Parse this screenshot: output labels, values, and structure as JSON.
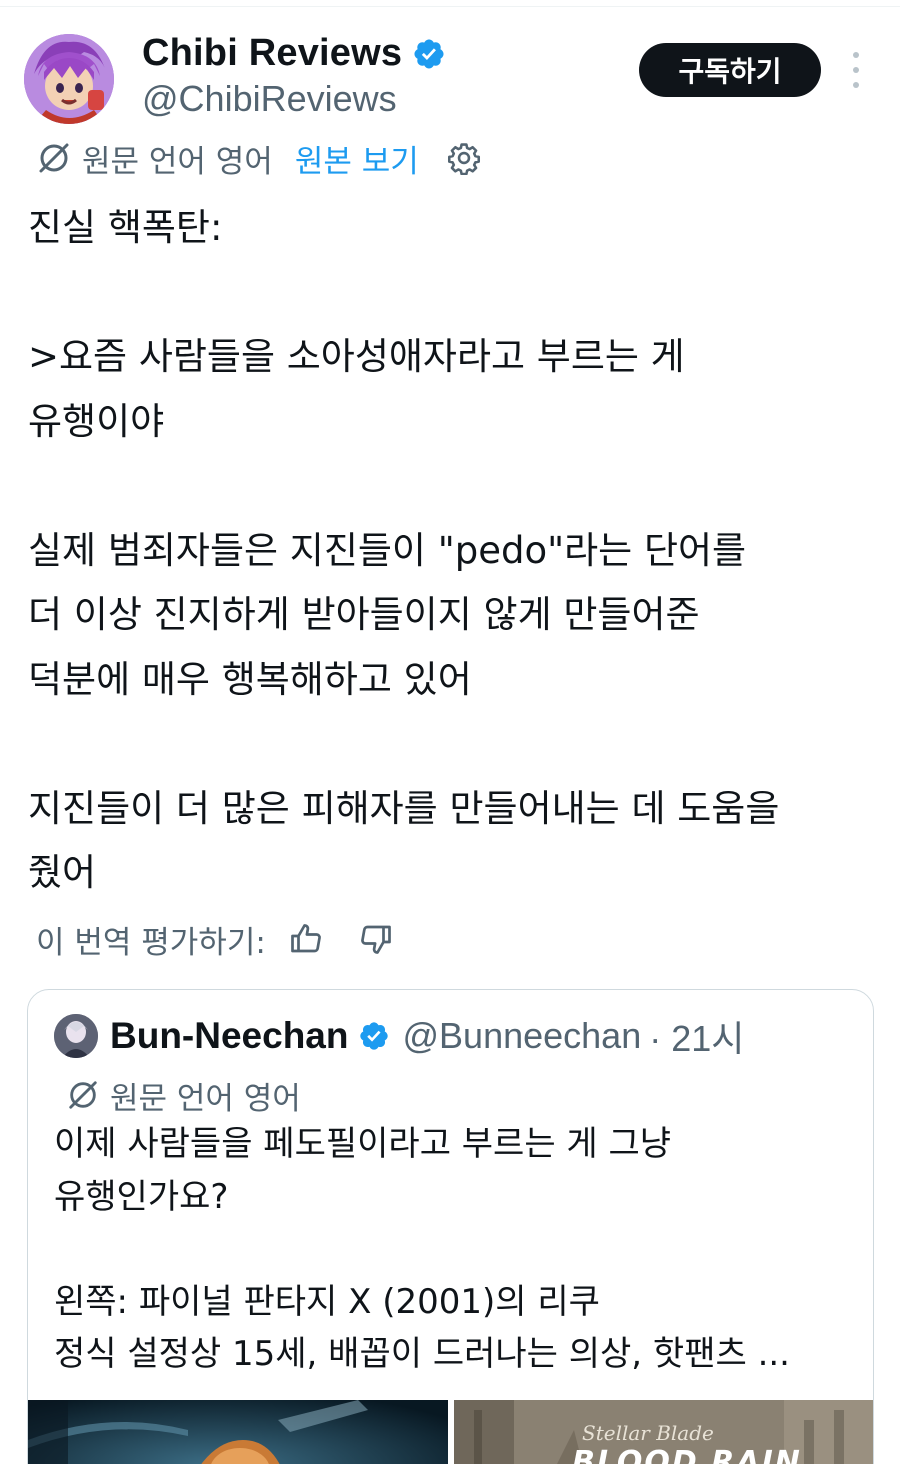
{
  "tweet": {
    "display_name": "Chibi Reviews",
    "handle": "@ChibiReviews",
    "subscribe_label": "구독하기",
    "translation": {
      "original_language": "원문 언어 영어",
      "view_original": "원본 보기"
    },
    "text": "진실 핵폭탄:\n\n>요즘 사람들을 소아성애자라고 부르는 게\n유행이야\n\n실제 범죄자들은 지진들이 \"pedo\"라는 단어를\n더 이상 진지하게 받아들이지 않게 만들어준\n덕분에 매우 행복해하고 있어\n\n지진들이 더 많은 피해자를 만들어내는 데 도움을\n줬어",
    "rate_label": "이 번역 평가하기:"
  },
  "quote": {
    "display_name": "Bun-Neechan",
    "handle": "@Bunneechan",
    "time": "· 21시",
    "original_language": "원문 언어 영어",
    "text": "이제 사람들을 페도필이라고 부르는 게 그냥\n유행인가요?\n\n왼쪽: 파이널 판타지 X (2001)의 리쿠\n정식 설정상 15세, 배꼽이 드러나는 의상, 핫팬츠 ...",
    "media_right_logo_script": "Stellar Blade",
    "media_right_logo_title": "BLOOD RAIN"
  },
  "colors": {
    "text": "#0f1419",
    "secondary": "#536471",
    "link": "#1d9bf0",
    "verified": "#1d9bf0",
    "border": "#cfd9de"
  },
  "icons": [
    "verified-badge-icon",
    "more-vert-icon",
    "translate-icon",
    "gear-icon",
    "thumbs-up-icon",
    "thumbs-down-icon"
  ]
}
